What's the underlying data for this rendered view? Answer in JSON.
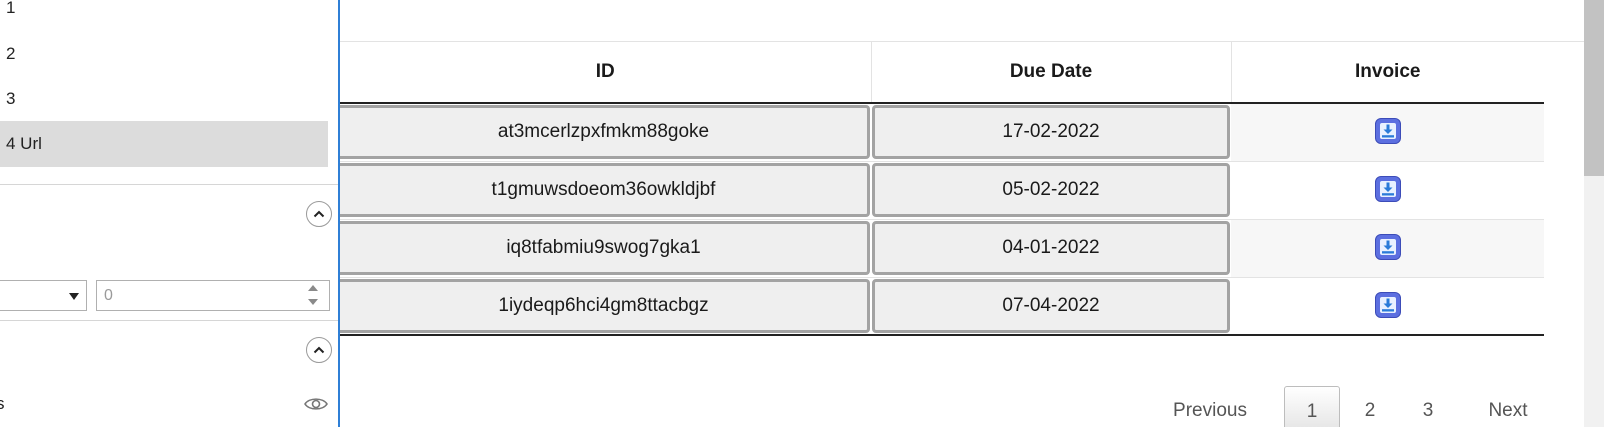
{
  "panel": {
    "options": [
      {
        "label": "1"
      },
      {
        "label": "2"
      },
      {
        "label": "3"
      },
      {
        "label": "4 Url"
      }
    ],
    "selected_index": 3,
    "number_input": {
      "value": "0"
    },
    "cut_label": "s"
  },
  "table": {
    "headers": [
      "ID",
      "Due Date",
      "Invoice"
    ],
    "rows": [
      {
        "id": "at3mcerlzpxfmkm88goke",
        "due": "17-02-2022"
      },
      {
        "id": "t1gmuwsdoeom36owkldjbf",
        "due": "05-02-2022"
      },
      {
        "id": "iq8tfabmiu9swog7gka1",
        "due": "04-01-2022"
      },
      {
        "id": "1iydeqp6hci4gm8ttacbgz",
        "due": "07-04-2022"
      }
    ]
  },
  "pagination": {
    "previous": "Previous",
    "pages": [
      "1",
      "2",
      "3"
    ],
    "current": "1",
    "next": "Next"
  },
  "icons": {
    "download": "download-icon",
    "collapse": "chevron-up-icon",
    "visibility": "eye-icon",
    "dropdown": "caret-down-icon"
  },
  "colors": {
    "panel_accent": "#2f7fd6",
    "download_button": "#5c6fe0",
    "selected_option": "#dcdcdc",
    "cell_fill": "#efefef"
  }
}
